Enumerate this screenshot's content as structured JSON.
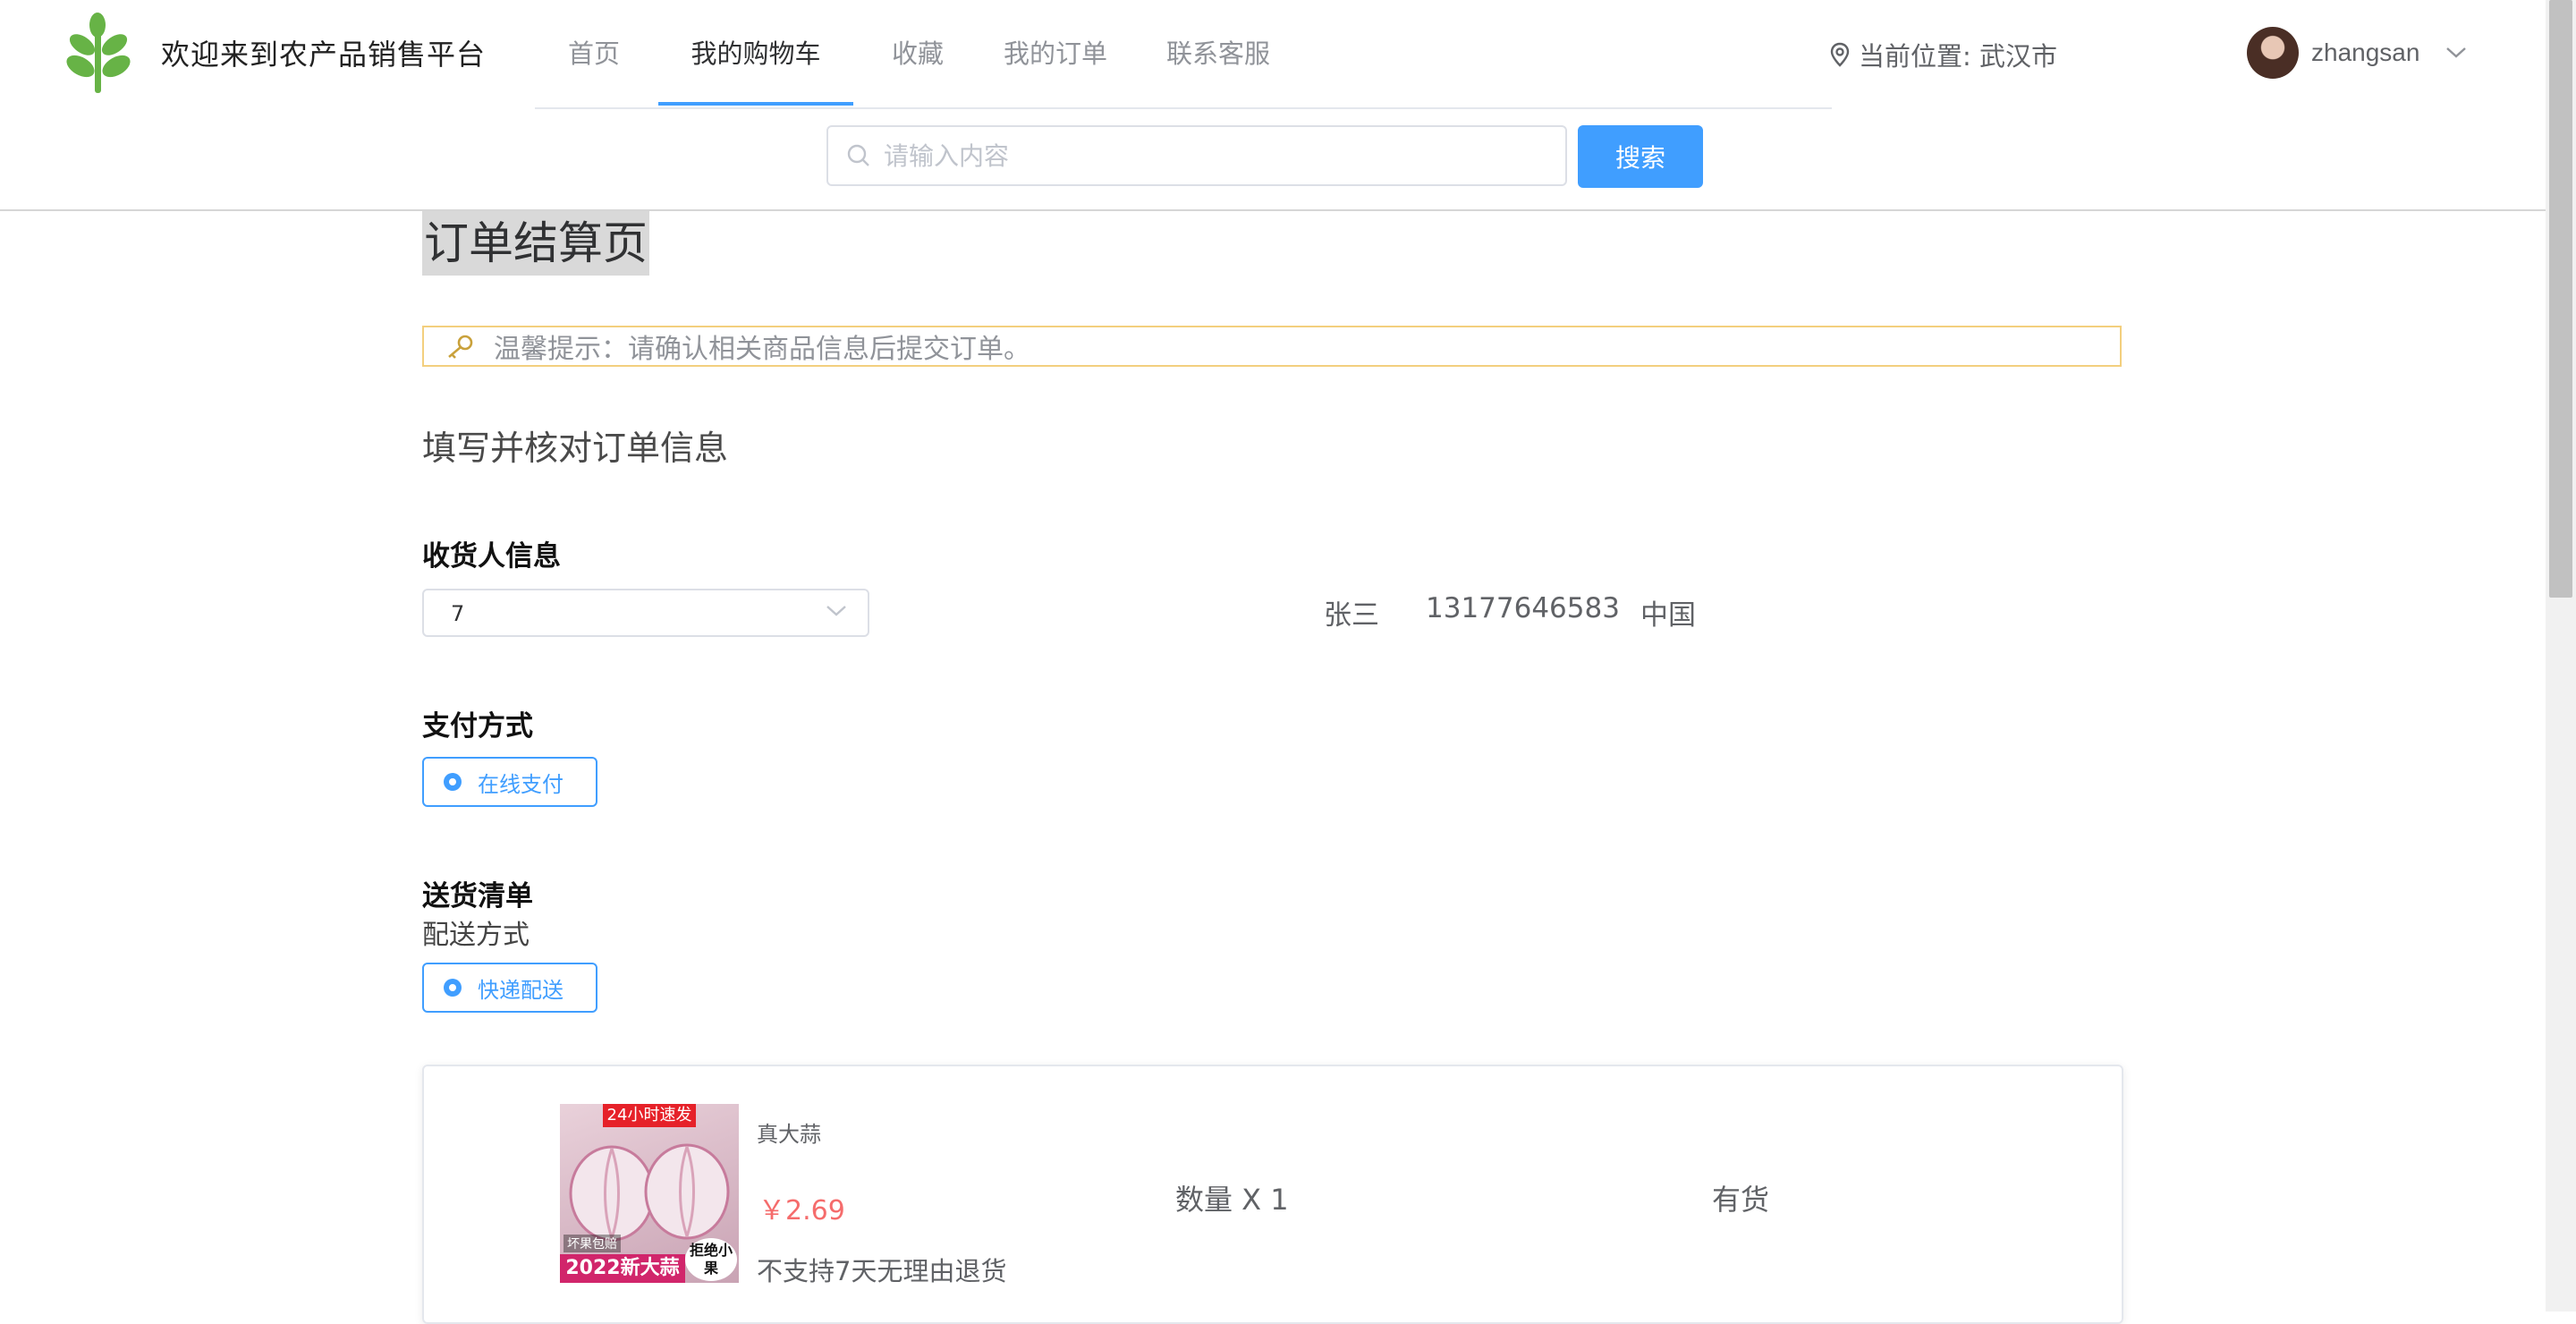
{
  "header": {
    "site_title": "欢迎来到农产品销售平台",
    "nav": [
      "首页",
      "我的购物车",
      "收藏",
      "我的订单",
      "联系客服"
    ],
    "active_nav": "我的购物车",
    "location_text": "当前位置: 武汉市",
    "username": "zhangsan",
    "search": {
      "placeholder": "请输入内容",
      "button_label": "搜索"
    }
  },
  "page": {
    "title": "订单结算页",
    "tip": "温馨提示：请确认相关商品信息后提交订单。",
    "section_title": "填写并核对订单信息",
    "receiver": {
      "label": "收货人信息",
      "selected": "7",
      "name": "张三",
      "phone": "13177646583",
      "region": "中国"
    },
    "payment": {
      "label": "支付方式",
      "option": "在线支付"
    },
    "delivery": {
      "label": "送货清单",
      "method_label": "配送方式",
      "option": "快递配送"
    },
    "item": {
      "badge_top": "24小时速发",
      "badge_small": "坏果包赔",
      "badge_bottom": "2022新大蒜",
      "badge_round": "拒绝小果",
      "name": "真大蒜",
      "price": "￥2.69",
      "note": "不支持7天无理由退货",
      "quantity": "数量 X 1",
      "stock": "有货"
    }
  },
  "colors": {
    "primary": "#409eff",
    "price": "#f56c6c",
    "tip_border": "#f3cf7e",
    "logo_green": "#67b346"
  },
  "icons": [
    "leaf-logo-icon",
    "location-pin-icon",
    "chevron-down-icon",
    "search-icon",
    "key-icon",
    "radio-checked-icon"
  ]
}
